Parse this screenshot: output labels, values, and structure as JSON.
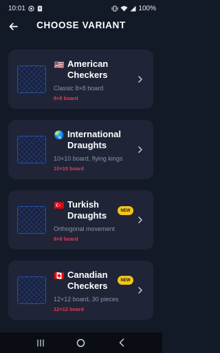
{
  "status_bar": {
    "time": "10:01",
    "battery": "100%"
  },
  "header": {
    "title": "CHOOSE VARIANT"
  },
  "variants": [
    {
      "flag": "🇺🇸",
      "name_line1": "American",
      "name_line2": "Checkers",
      "description": "Classic 8×8 board",
      "board_size": "8×8 board",
      "badge": ""
    },
    {
      "flag": "🌏",
      "name_line1": "International",
      "name_line2": "Draughts",
      "description": "10×10 board, flying kings",
      "board_size": "10×10 board",
      "badge": ""
    },
    {
      "flag": "🇹🇷",
      "name_line1": "Turkish",
      "name_line2": "Draughts",
      "description": "Orthogonal movement",
      "board_size": "8×8 board",
      "badge": "NEW"
    },
    {
      "flag": "🇨🇦",
      "name_line1": "Canadian",
      "name_line2": "Checkers",
      "description": "12×12 board, 30 pieces",
      "board_size": "12×12 board",
      "badge": "NEW"
    }
  ],
  "colors": {
    "background": "#131a27",
    "card": "#1f2537",
    "accent_red": "#e23a54",
    "badge_yellow": "#f4c51a",
    "thumbnail_border": "#2a4fa8"
  }
}
